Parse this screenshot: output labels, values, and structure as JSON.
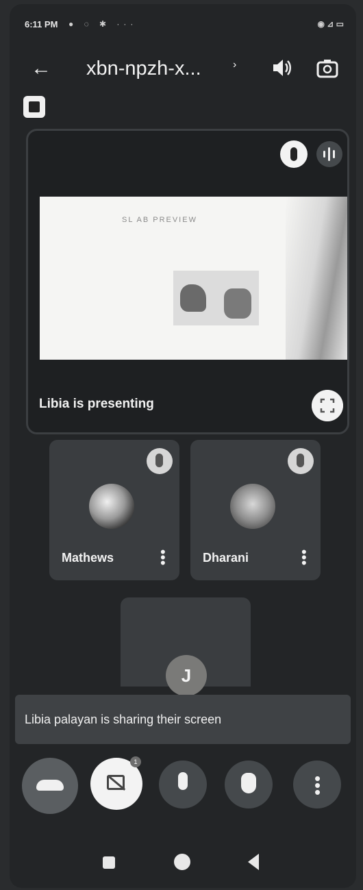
{
  "status_bar": {
    "time": "6:11 PM",
    "left_icons": "● ◌ ✱ ···",
    "right_icons": "◉ ⊿ ▭"
  },
  "top_bar": {
    "back_icon": "arrow-left-icon",
    "meeting_code": "xbn-npzh-x...",
    "caret": "›",
    "speaker_icon": "speaker-icon",
    "camera_switch_icon": "switch-camera-icon"
  },
  "presentation": {
    "slide_heading": "SL  AB  PREVIEW",
    "presenter_label": "Libia is presenting"
  },
  "participants": [
    {
      "name": "Mathews"
    },
    {
      "name": "Dharani"
    }
  ],
  "self_tile": {
    "initial": "J"
  },
  "banner": {
    "text": "Libia palayan is sharing their screen"
  },
  "controls": {
    "share_badge": "1"
  },
  "colors": {
    "background": "#232527",
    "tile": "#3a3d40",
    "button_dark": "#45494c",
    "accent_light": "#f3f3f3"
  }
}
